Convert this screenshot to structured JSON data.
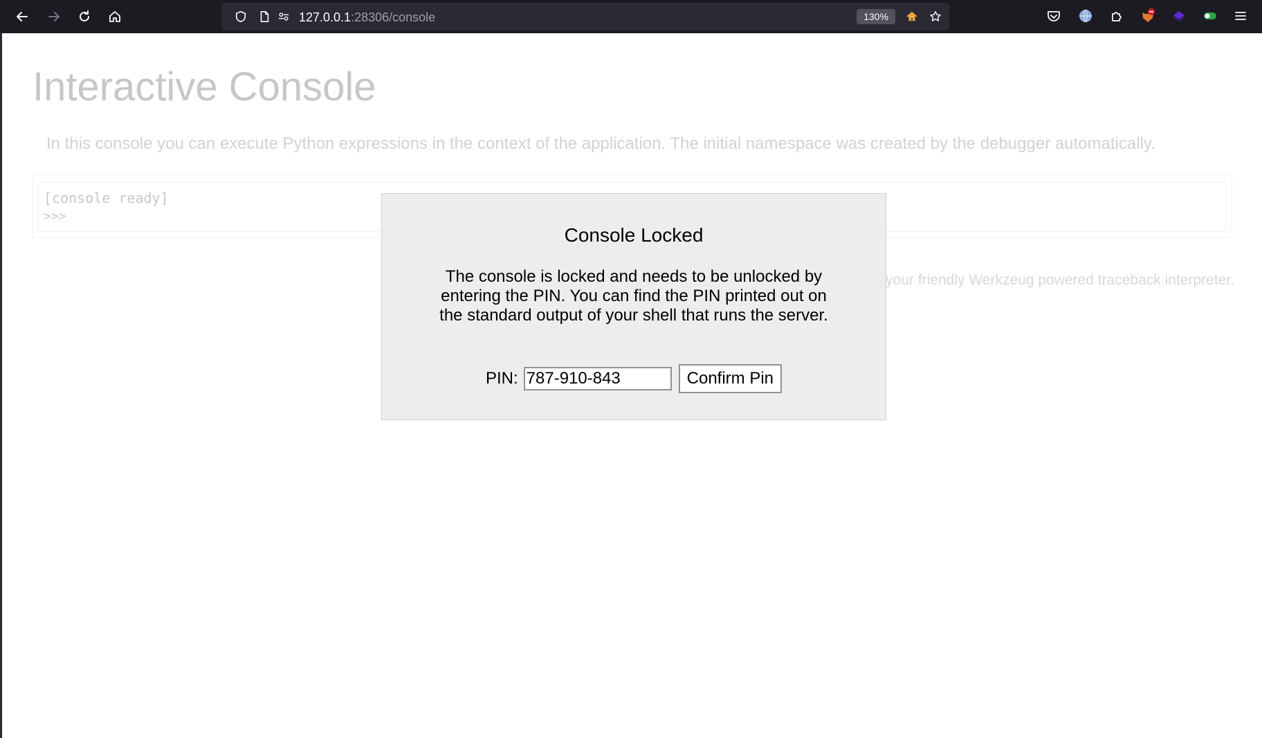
{
  "browser": {
    "url_host": "127.0.0.1",
    "url_rest": ":28306/console",
    "zoom": "130%",
    "icons": {
      "back": "back-arrow-icon",
      "forward": "forward-arrow-icon",
      "reload": "reload-icon",
      "home": "home-icon",
      "shield": "shield-icon",
      "page": "page-icon",
      "permissions": "permissions-icon",
      "home_shortcut": "home-shortcut-icon",
      "bookmark": "bookmark-star-icon",
      "pocket": "pocket-icon",
      "vpn": "vpn-globe-icon",
      "extensions": "extensions-puzzle-icon",
      "ext1": "extension-fox-icon",
      "ext2": "extension-purple-icon",
      "ext3": "extension-toggle-icon",
      "menu": "hamburger-menu-icon"
    },
    "accent": "#1c1b22"
  },
  "page": {
    "title": "Interactive Console",
    "explanation": "In this console you can execute Python expressions in the context of the application. The initial namespace was created by the debugger automatically.",
    "console_ready": "[console ready]",
    "prompt": ">>>",
    "footer": "your friendly Werkzeug powered traceback interpreter."
  },
  "dialog": {
    "title": "Console Locked",
    "message": "The console is locked and needs to be unlocked by entering the PIN. You can find the PIN printed out on the standard output of your shell that runs the server.",
    "pin_label": "PIN:",
    "pin_value": "787-910-843",
    "confirm_label": "Confirm Pin"
  }
}
